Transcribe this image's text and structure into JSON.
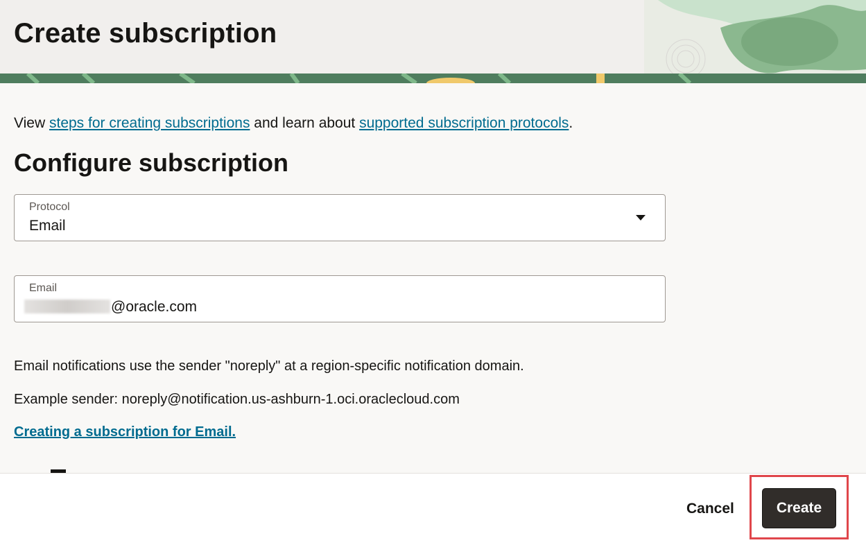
{
  "header": {
    "title": "Create subscription"
  },
  "intro": {
    "prefix": "View ",
    "link1": "steps for creating subscriptions",
    "middle": " and learn about ",
    "link2": "supported subscription protocols",
    "suffix": "."
  },
  "section": {
    "title": "Configure subscription"
  },
  "protocol": {
    "label": "Protocol",
    "value": "Email"
  },
  "email": {
    "label": "Email",
    "value_visible": "@oracle.com"
  },
  "notes": {
    "line1": "Email notifications use the sender \"noreply\" at a region-specific notification domain.",
    "line2": "Example sender: noreply@notification.us-ashburn-1.oci.oraclecloud.com",
    "link": "Creating a subscription for Email."
  },
  "footer": {
    "cancel": "Cancel",
    "create": "Create"
  },
  "colors": {
    "link": "#006b8f",
    "primary_button": "#312d2a",
    "highlight": "#e0464b",
    "banner_green": "#4f7d5e"
  }
}
